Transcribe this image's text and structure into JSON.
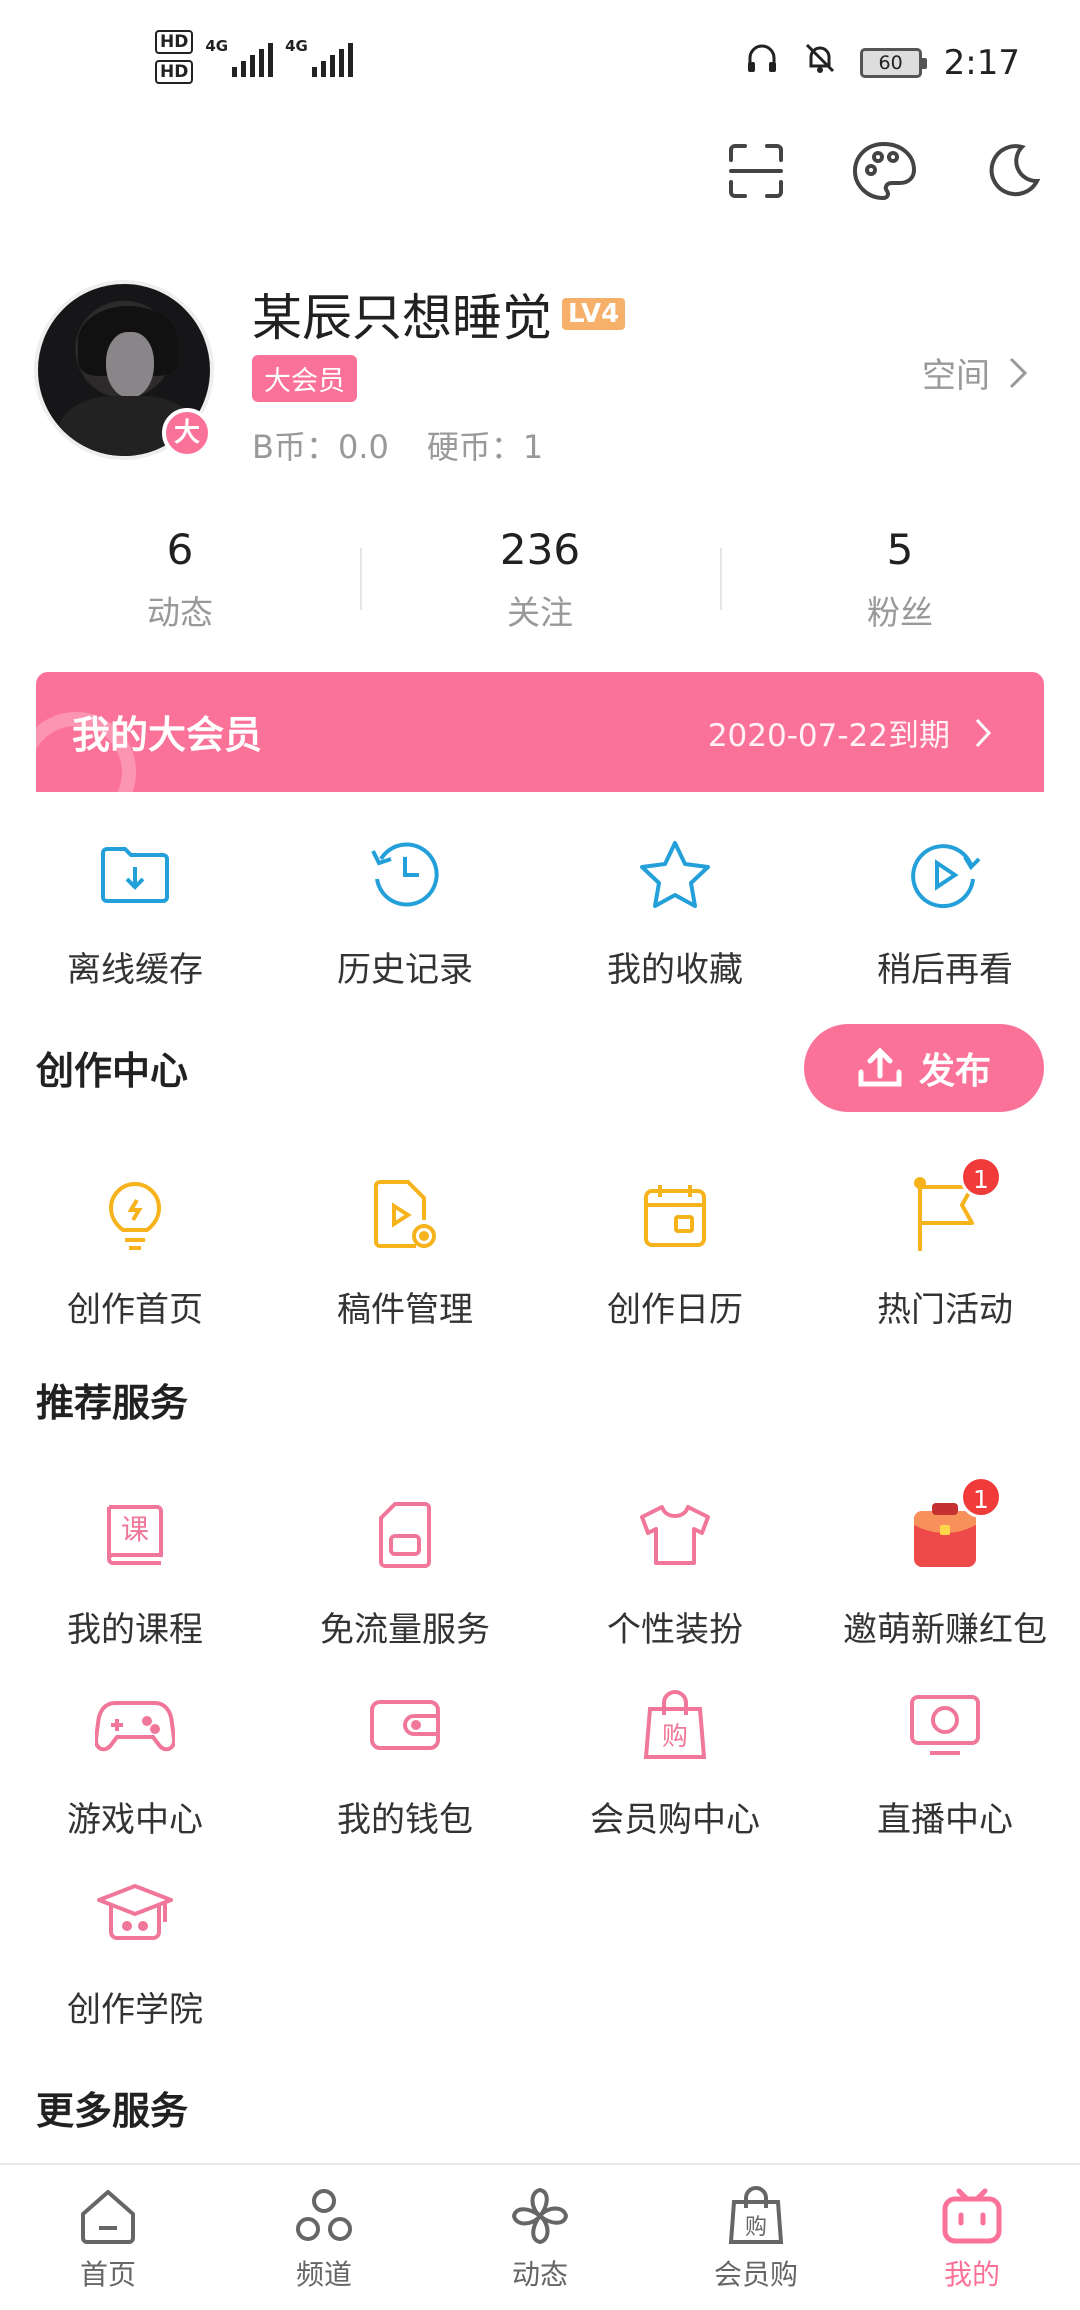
{
  "status_bar": {
    "hd1": "HD",
    "hd2": "HD",
    "net1": "4G",
    "net2": "4G",
    "battery": "60",
    "time": "2:17"
  },
  "header_icons": [
    "scan-icon",
    "palette-icon",
    "moon-icon"
  ],
  "profile": {
    "username": "某辰只想睡觉",
    "level": "LV4",
    "vip_tag": "大会员",
    "avatar_badge": "大",
    "b_coins": "B币：0.0",
    "coins": "硬币：1",
    "space_link": "空间"
  },
  "stats": [
    {
      "value": "6",
      "label": "动态"
    },
    {
      "value": "236",
      "label": "关注"
    },
    {
      "value": "5",
      "label": "粉丝"
    }
  ],
  "vip_banner": {
    "title": "我的大会员",
    "expiry": "2020-07-22到期"
  },
  "quick_actions": [
    {
      "label": "离线缓存",
      "icon": "download-folder-icon"
    },
    {
      "label": "历史记录",
      "icon": "history-clock-icon"
    },
    {
      "label": "我的收藏",
      "icon": "star-icon"
    },
    {
      "label": "稍后再看",
      "icon": "watch-later-icon"
    }
  ],
  "creation": {
    "title": "创作中心",
    "publish_label": "发布",
    "items": [
      {
        "label": "创作首页",
        "icon": "lightbulb-icon"
      },
      {
        "label": "稿件管理",
        "icon": "manuscript-icon"
      },
      {
        "label": "创作日历",
        "icon": "calendar-icon"
      },
      {
        "label": "热门活动",
        "icon": "flag-icon",
        "badge": "1"
      }
    ]
  },
  "recommended": {
    "title": "推荐服务",
    "items": [
      {
        "label": "我的课程",
        "icon": "course-book-icon",
        "glyph": "课"
      },
      {
        "label": "免流量服务",
        "icon": "sim-card-icon"
      },
      {
        "label": "个性装扮",
        "icon": "tshirt-icon"
      },
      {
        "label": "邀萌新赚红包",
        "icon": "red-envelope-icon",
        "badge": "1"
      },
      {
        "label": "游戏中心",
        "icon": "gamepad-icon"
      },
      {
        "label": "我的钱包",
        "icon": "wallet-icon"
      },
      {
        "label": "会员购中心",
        "icon": "shopping-bag-icon",
        "glyph": "购"
      },
      {
        "label": "直播中心",
        "icon": "live-tv-icon"
      },
      {
        "label": "创作学院",
        "icon": "graduation-cap-icon"
      }
    ]
  },
  "more_services": {
    "title": "更多服务"
  },
  "bottom_nav": [
    {
      "label": "首页",
      "icon": "home-icon"
    },
    {
      "label": "频道",
      "icon": "channel-icon"
    },
    {
      "label": "动态",
      "icon": "pinwheel-icon"
    },
    {
      "label": "会员购",
      "icon": "shop-bag-icon",
      "glyph": "购"
    },
    {
      "label": "我的",
      "icon": "tv-face-icon",
      "active": true
    }
  ],
  "colors": {
    "pink": "#fb7299",
    "blue": "#23a0d9",
    "yellow": "#f6b31c",
    "text": "#212121",
    "gray": "#999999"
  }
}
